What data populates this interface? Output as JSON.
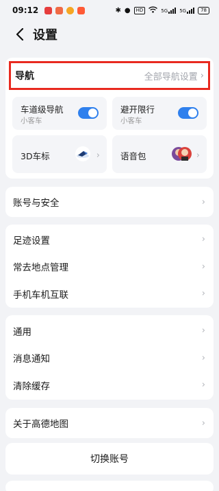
{
  "status_bar": {
    "time": "09:12",
    "net_badge": "HD",
    "signal1": "5G",
    "signal2": "5G",
    "battery": "78"
  },
  "header": {
    "title": "设置"
  },
  "navigation": {
    "title": "导航",
    "all_settings": "全部导航设置",
    "tiles": [
      {
        "label": "车道级导航",
        "sub": "小客车",
        "toggle_on": true
      },
      {
        "label": "避开限行",
        "sub": "小客车",
        "toggle_on": true
      },
      {
        "label": "3D车标"
      },
      {
        "label": "语音包"
      }
    ]
  },
  "account": {
    "label": "账号与安全"
  },
  "group2": {
    "items": [
      {
        "label": "足迹设置"
      },
      {
        "label": "常去地点管理"
      },
      {
        "label": "手机车机互联"
      }
    ]
  },
  "group3": {
    "items": [
      {
        "label": "通用"
      },
      {
        "label": "消息通知"
      },
      {
        "label": "清除缓存"
      }
    ]
  },
  "about": {
    "label": "关于高德地图"
  },
  "switch_account": {
    "label": "切换账号"
  },
  "colors": {
    "accent": "#2f80ed",
    "highlight": "#e8291f",
    "background": "#f2f3f6"
  }
}
